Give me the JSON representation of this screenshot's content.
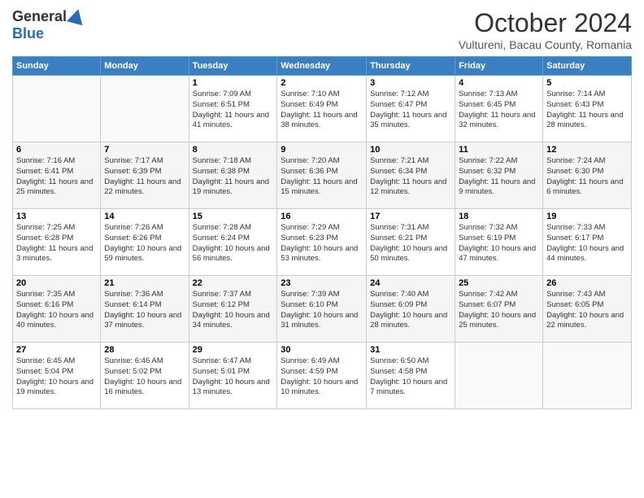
{
  "header": {
    "logo_general": "General",
    "logo_blue": "Blue",
    "month_title": "October 2024",
    "location": "Vultureni, Bacau County, Romania"
  },
  "days_of_week": [
    "Sunday",
    "Monday",
    "Tuesday",
    "Wednesday",
    "Thursday",
    "Friday",
    "Saturday"
  ],
  "weeks": [
    [
      {
        "day": "",
        "content": ""
      },
      {
        "day": "",
        "content": ""
      },
      {
        "day": "1",
        "content": "Sunrise: 7:09 AM\nSunset: 6:51 PM\nDaylight: 11 hours and 41 minutes."
      },
      {
        "day": "2",
        "content": "Sunrise: 7:10 AM\nSunset: 6:49 PM\nDaylight: 11 hours and 38 minutes."
      },
      {
        "day": "3",
        "content": "Sunrise: 7:12 AM\nSunset: 6:47 PM\nDaylight: 11 hours and 35 minutes."
      },
      {
        "day": "4",
        "content": "Sunrise: 7:13 AM\nSunset: 6:45 PM\nDaylight: 11 hours and 32 minutes."
      },
      {
        "day": "5",
        "content": "Sunrise: 7:14 AM\nSunset: 6:43 PM\nDaylight: 11 hours and 28 minutes."
      }
    ],
    [
      {
        "day": "6",
        "content": "Sunrise: 7:16 AM\nSunset: 6:41 PM\nDaylight: 11 hours and 25 minutes."
      },
      {
        "day": "7",
        "content": "Sunrise: 7:17 AM\nSunset: 6:39 PM\nDaylight: 11 hours and 22 minutes."
      },
      {
        "day": "8",
        "content": "Sunrise: 7:18 AM\nSunset: 6:38 PM\nDaylight: 11 hours and 19 minutes."
      },
      {
        "day": "9",
        "content": "Sunrise: 7:20 AM\nSunset: 6:36 PM\nDaylight: 11 hours and 15 minutes."
      },
      {
        "day": "10",
        "content": "Sunrise: 7:21 AM\nSunset: 6:34 PM\nDaylight: 11 hours and 12 minutes."
      },
      {
        "day": "11",
        "content": "Sunrise: 7:22 AM\nSunset: 6:32 PM\nDaylight: 11 hours and 9 minutes."
      },
      {
        "day": "12",
        "content": "Sunrise: 7:24 AM\nSunset: 6:30 PM\nDaylight: 11 hours and 6 minutes."
      }
    ],
    [
      {
        "day": "13",
        "content": "Sunrise: 7:25 AM\nSunset: 6:28 PM\nDaylight: 11 hours and 3 minutes."
      },
      {
        "day": "14",
        "content": "Sunrise: 7:26 AM\nSunset: 6:26 PM\nDaylight: 10 hours and 59 minutes."
      },
      {
        "day": "15",
        "content": "Sunrise: 7:28 AM\nSunset: 6:24 PM\nDaylight: 10 hours and 56 minutes."
      },
      {
        "day": "16",
        "content": "Sunrise: 7:29 AM\nSunset: 6:23 PM\nDaylight: 10 hours and 53 minutes."
      },
      {
        "day": "17",
        "content": "Sunrise: 7:31 AM\nSunset: 6:21 PM\nDaylight: 10 hours and 50 minutes."
      },
      {
        "day": "18",
        "content": "Sunrise: 7:32 AM\nSunset: 6:19 PM\nDaylight: 10 hours and 47 minutes."
      },
      {
        "day": "19",
        "content": "Sunrise: 7:33 AM\nSunset: 6:17 PM\nDaylight: 10 hours and 44 minutes."
      }
    ],
    [
      {
        "day": "20",
        "content": "Sunrise: 7:35 AM\nSunset: 6:16 PM\nDaylight: 10 hours and 40 minutes."
      },
      {
        "day": "21",
        "content": "Sunrise: 7:36 AM\nSunset: 6:14 PM\nDaylight: 10 hours and 37 minutes."
      },
      {
        "day": "22",
        "content": "Sunrise: 7:37 AM\nSunset: 6:12 PM\nDaylight: 10 hours and 34 minutes."
      },
      {
        "day": "23",
        "content": "Sunrise: 7:39 AM\nSunset: 6:10 PM\nDaylight: 10 hours and 31 minutes."
      },
      {
        "day": "24",
        "content": "Sunrise: 7:40 AM\nSunset: 6:09 PM\nDaylight: 10 hours and 28 minutes."
      },
      {
        "day": "25",
        "content": "Sunrise: 7:42 AM\nSunset: 6:07 PM\nDaylight: 10 hours and 25 minutes."
      },
      {
        "day": "26",
        "content": "Sunrise: 7:43 AM\nSunset: 6:05 PM\nDaylight: 10 hours and 22 minutes."
      }
    ],
    [
      {
        "day": "27",
        "content": "Sunrise: 6:45 AM\nSunset: 5:04 PM\nDaylight: 10 hours and 19 minutes."
      },
      {
        "day": "28",
        "content": "Sunrise: 6:46 AM\nSunset: 5:02 PM\nDaylight: 10 hours and 16 minutes."
      },
      {
        "day": "29",
        "content": "Sunrise: 6:47 AM\nSunset: 5:01 PM\nDaylight: 10 hours and 13 minutes."
      },
      {
        "day": "30",
        "content": "Sunrise: 6:49 AM\nSunset: 4:59 PM\nDaylight: 10 hours and 10 minutes."
      },
      {
        "day": "31",
        "content": "Sunrise: 6:50 AM\nSunset: 4:58 PM\nDaylight: 10 hours and 7 minutes."
      },
      {
        "day": "",
        "content": ""
      },
      {
        "day": "",
        "content": ""
      }
    ]
  ]
}
